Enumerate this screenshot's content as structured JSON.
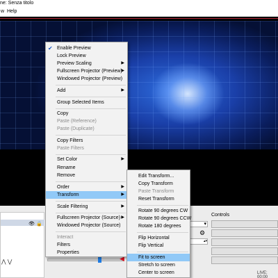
{
  "window": {
    "title": "ne: Senza titolo"
  },
  "menubar": {
    "items": [
      "w",
      "Help"
    ]
  },
  "context_menu": {
    "items": [
      {
        "label": "Enable Preview",
        "checked": true
      },
      {
        "label": "Lock Preview"
      },
      {
        "label": "Preview Scaling",
        "submenu": true
      },
      {
        "label": "Fullscreen Projector (Preview)",
        "submenu": true
      },
      {
        "label": "Windowed Projector (Preview)"
      },
      {
        "label": "Add",
        "submenu": true
      },
      {
        "label": "Group Selected Items"
      },
      {
        "label": "Copy"
      },
      {
        "label": "Paste (Reference)",
        "disabled": true
      },
      {
        "label": "Paste (Duplicate)",
        "disabled": true
      },
      {
        "label": "Copy Filters"
      },
      {
        "label": "Paste Filters",
        "disabled": true
      },
      {
        "label": "Set Color",
        "submenu": true
      },
      {
        "label": "Rename"
      },
      {
        "label": "Remove"
      },
      {
        "label": "Order",
        "submenu": true
      },
      {
        "label": "Transform",
        "submenu": true,
        "highlighted": true
      },
      {
        "label": "Scale Filtering",
        "submenu": true
      },
      {
        "label": "Fullscreen Projector (Source)",
        "submenu": true
      },
      {
        "label": "Windowed Projector (Source)"
      },
      {
        "label": "Interact",
        "disabled": true
      },
      {
        "label": "Filters"
      },
      {
        "label": "Properties"
      }
    ]
  },
  "transform_menu": {
    "items": [
      {
        "label": "Edit Transform..."
      },
      {
        "label": "Copy Transform"
      },
      {
        "label": "Paste Transform",
        "disabled": true
      },
      {
        "label": "Reset Transform"
      },
      {
        "label": "Rotate 90 degrees CW"
      },
      {
        "label": "Rotate 90 degrees CCW"
      },
      {
        "label": "Rotate 180 degrees"
      },
      {
        "label": "Flip Horizontal"
      },
      {
        "label": "Flip Vertical"
      },
      {
        "label": "Fit to screen",
        "highlighted": true
      },
      {
        "label": "Stretch to screen"
      },
      {
        "label": "Center to screen"
      }
    ]
  },
  "docks": {
    "controls_title": "Controls",
    "status": "LIVE: 00:00",
    "arrows": "⋀ ⋁"
  },
  "colors": {
    "highlight": "#91c9f7",
    "accent_blue": "#1e7be2",
    "mute_red": "#d12"
  }
}
